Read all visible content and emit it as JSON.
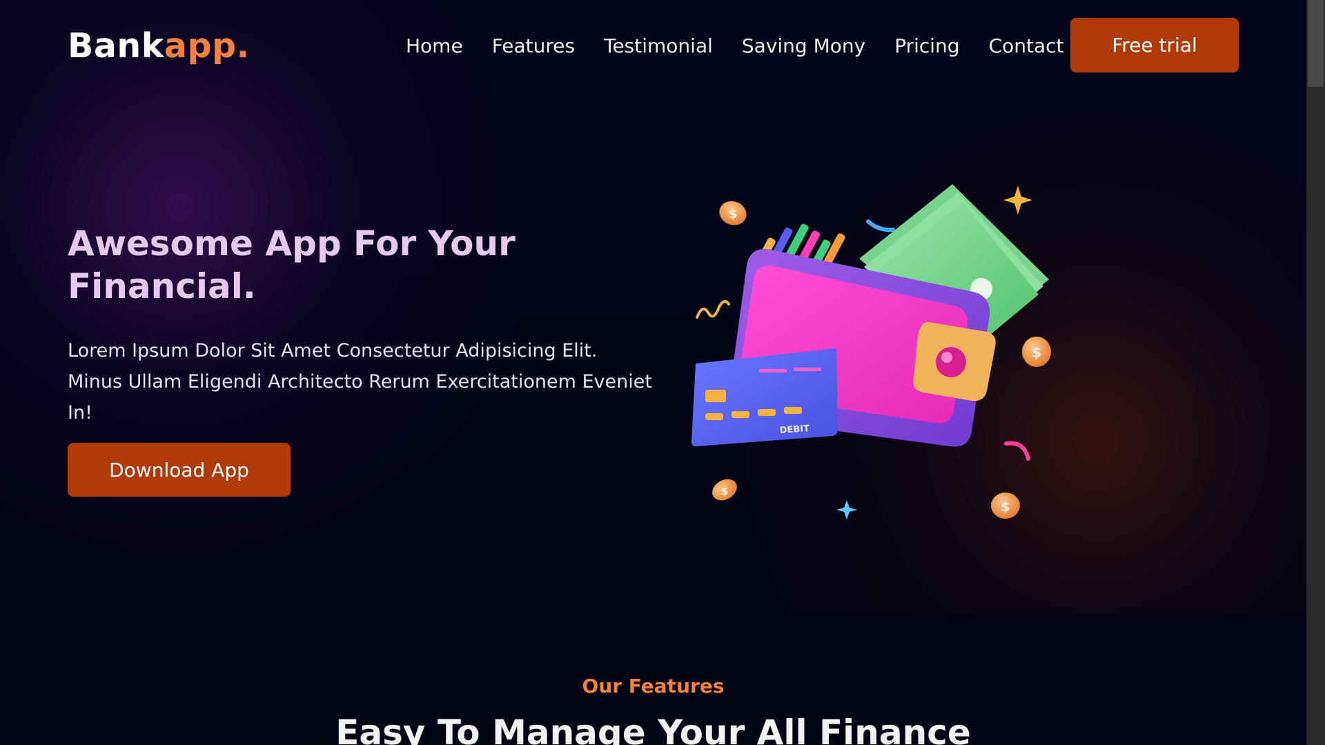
{
  "header": {
    "logo_main": "Bank",
    "logo_accent": "app.",
    "nav": [
      "Home",
      "Features",
      "Testimonial",
      "Saving Mony",
      "Pricing",
      "Contact"
    ],
    "cta_label": "Free trial"
  },
  "hero": {
    "title": "Awesome App For Your Financial.",
    "description": "Lorem Ipsum Dolor Sit Amet Consectetur Adipisicing Elit. Minus Ullam Eligendi Architecto Rerum Exercitationem Eveniet In!",
    "download_label": "Download App",
    "illustration": {
      "icon": "wallet-icon",
      "card_label": "DEBIT",
      "coin_symbol": "$"
    }
  },
  "features": {
    "eyebrow": "Our Features",
    "title": "Easy To Manage Your All Finance"
  },
  "colors": {
    "background": "#03041a",
    "accent": "#f5813a",
    "button": "#b03a08",
    "hero_title": "#e8c9ee"
  }
}
